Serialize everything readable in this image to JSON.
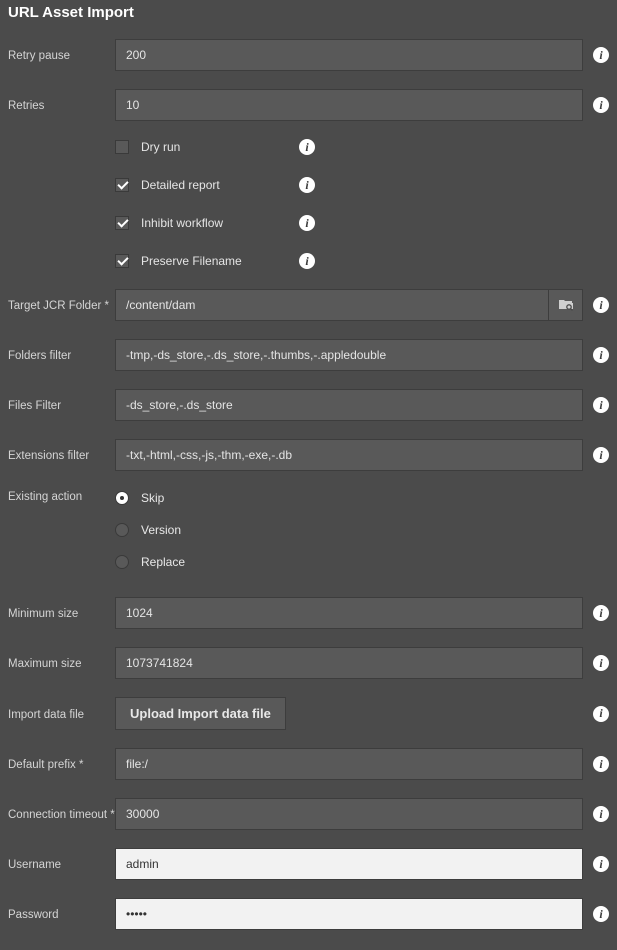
{
  "title": "URL Asset Import",
  "fields": {
    "retry_pause": {
      "label": "Retry pause",
      "value": "200"
    },
    "retries": {
      "label": "Retries",
      "value": "10"
    },
    "target_folder": {
      "label": "Target JCR Folder *",
      "value": "/content/dam"
    },
    "folders_filter": {
      "label": "Folders filter",
      "value": "-tmp,-ds_store,-.ds_store,-.thumbs,-.appledouble"
    },
    "files_filter": {
      "label": "Files Filter",
      "value": "-ds_store,-.ds_store"
    },
    "extensions_filter": {
      "label": "Extensions filter",
      "value": "-txt,-html,-css,-js,-thm,-exe,-.db"
    },
    "min_size": {
      "label": "Minimum size",
      "value": "1024"
    },
    "max_size": {
      "label": "Maximum size",
      "value": "1073741824"
    },
    "default_prefix": {
      "label": "Default prefix *",
      "value": "file:/"
    },
    "connection_timeout": {
      "label": "Connection timeout *",
      "value": "30000"
    },
    "username": {
      "label": "Username",
      "value": "admin"
    },
    "password": {
      "label": "Password",
      "value": "•••••"
    }
  },
  "checkboxes": {
    "dry_run": {
      "label": "Dry run",
      "checked": false
    },
    "detailed_report": {
      "label": "Detailed report",
      "checked": true
    },
    "inhibit_workflow": {
      "label": "Inhibit workflow",
      "checked": true
    },
    "preserve_filename": {
      "label": "Preserve Filename",
      "checked": true
    }
  },
  "existing_action": {
    "label": "Existing action",
    "options": [
      {
        "label": "Skip",
        "selected": true
      },
      {
        "label": "Version",
        "selected": false
      },
      {
        "label": "Replace",
        "selected": false
      }
    ]
  },
  "import_file": {
    "label": "Import data file",
    "button": "Upload Import data file"
  }
}
